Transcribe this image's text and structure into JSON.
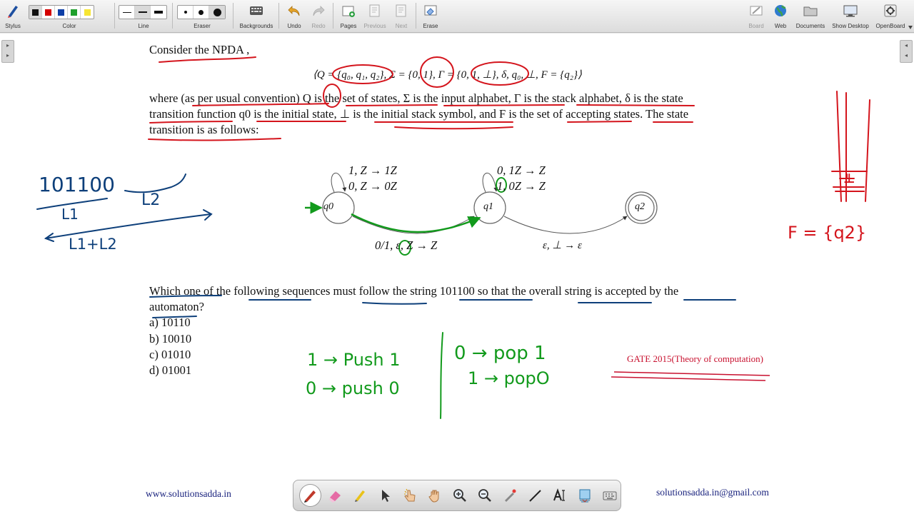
{
  "toolbar": {
    "stylus": "Stylus",
    "color": "Color",
    "line": "Line",
    "eraser": "Eraser",
    "backgrounds": "Backgrounds",
    "undo": "Undo",
    "redo": "Redo",
    "pages": "Pages",
    "previous": "Previous",
    "next": "Next",
    "erase": "Erase",
    "board": "Board",
    "web": "Web",
    "documents": "Documents",
    "show_desktop": "Show Desktop",
    "openboard": "OpenBoard",
    "swatch_colors": [
      "#111111",
      "#d40000",
      "#0d3ea6",
      "#1fa02c",
      "#f6e533"
    ]
  },
  "document": {
    "consider": "Consider the NPDA ,",
    "tuple": "⟨Q = {q₀, q₁, q₂}, Σ = {0, 1}, Γ = {0, 1, ⊥}, δ, q₀, ⊥, F = {q₂}⟩",
    "desc_line1": "where (as per usual convention) Q is the set of states, Σ is the input alphabet, Γ is the stack alphabet, δ is the state",
    "desc_line2": "transition function q0 is the initial state, ⊥ is the initial stack symbol, and F is the set of accepting states. The state",
    "desc_line3": "transition is as follows:",
    "question_line1": "Which one of the following sequences must follow the string 101100 so that the overall string is accepted by the",
    "question_line2": "automaton?",
    "options": [
      "a) 10110",
      "b) 10010",
      "c) 01010",
      "d) 01001"
    ],
    "gate_label": "GATE 2015(Theory of computation)",
    "footer_left": "www.solutionsadda.in",
    "footer_right": "solutionsadda.in@gmail.com"
  },
  "automaton": {
    "states": [
      "q0",
      "q1",
      "q2"
    ],
    "q0_loop_1": "1, Z → 1Z",
    "q0_loop_2": "0, Z → 0Z",
    "q1_loop_1": "0, 1Z → Z",
    "q1_loop_2": "1, 0Z → Z",
    "edge_q0_q1": "0/1, ε, Z → Z",
    "edge_q1_q2": "ε, ⊥ → ε"
  },
  "annotations": {
    "string": "101100",
    "l1": "L1",
    "l2": "L2",
    "l1_plus_l2": "L1+L2",
    "push1": "1 → Push 1",
    "push0": "0 → push 0",
    "pop1": "0 → pop 1",
    "pop0": "1 → popO",
    "final": "F = {q2}",
    "stack_bottom": "⊥"
  },
  "colors": {
    "red_ink": "#d4141c",
    "blue_ink": "#0d3f7a",
    "green_ink": "#129a1c",
    "gate_red": "#c8102e"
  }
}
